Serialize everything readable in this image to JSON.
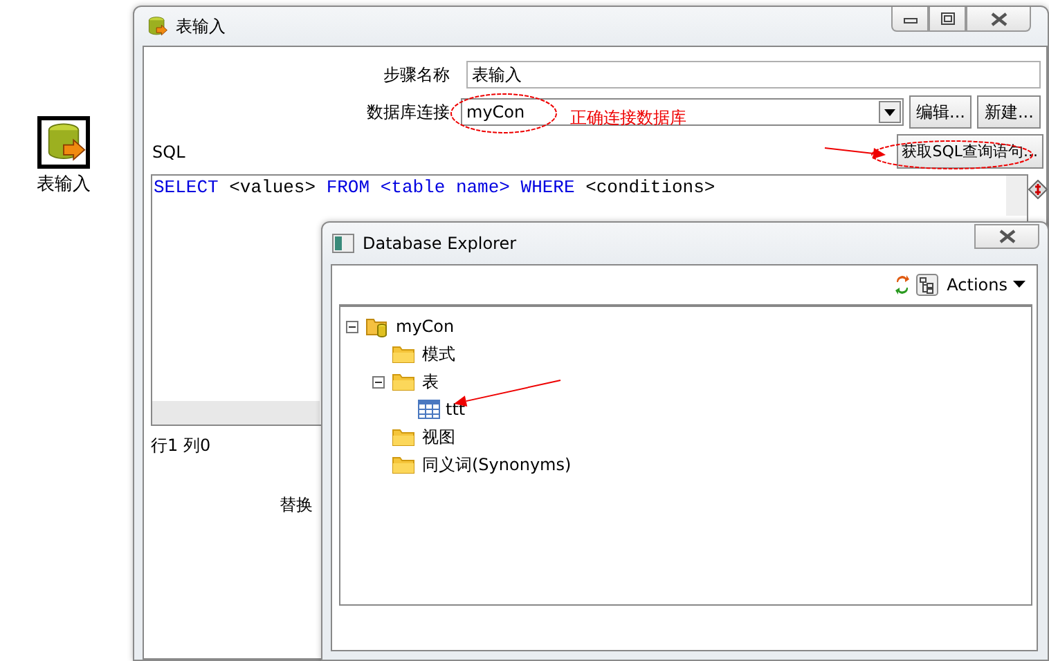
{
  "desktop_icon": {
    "label": "表输入"
  },
  "window": {
    "title": "表输入",
    "step_name": {
      "label": "步骤名称",
      "value": "表输入"
    },
    "connection": {
      "label": "数据库连接",
      "value": "myCon",
      "buttons": [
        "编辑...",
        "新建..."
      ]
    },
    "sql": {
      "label": "SQL",
      "button": "获取SQL查询语句...",
      "tokens": [
        {
          "text": "SELECT",
          "kind": "keyword"
        },
        {
          "text": "<values>",
          "kind": "plain"
        },
        {
          "text": "FROM",
          "kind": "keyword"
        },
        {
          "text": "<table name>",
          "kind": "keyword"
        },
        {
          "text": "WHERE",
          "kind": "keyword"
        },
        {
          "text": "<conditions>",
          "kind": "plain"
        }
      ]
    },
    "cursor_position": "行1 列0",
    "replace_label": "替换"
  },
  "database_explorer": {
    "title": "Database Explorer",
    "actions": "Actions",
    "tree": [
      {
        "label": "myCon",
        "kind": "connection",
        "expanded": true,
        "children": [
          {
            "label": "模式",
            "kind": "folder"
          },
          {
            "label": "表",
            "kind": "folder",
            "expanded": true,
            "children": [
              {
                "label": "ttt",
                "kind": "table"
              }
            ]
          },
          {
            "label": "视图",
            "kind": "folder"
          },
          {
            "label": "同义词(Synonyms)",
            "kind": "folder"
          }
        ]
      }
    ]
  },
  "annotations": [
    {
      "kind": "ellipse"
    },
    {
      "kind": "note",
      "text": "正确连接数据库"
    },
    {
      "kind": "arrow"
    },
    {
      "kind": "ellipse"
    },
    {
      "kind": "arrow"
    }
  ]
}
